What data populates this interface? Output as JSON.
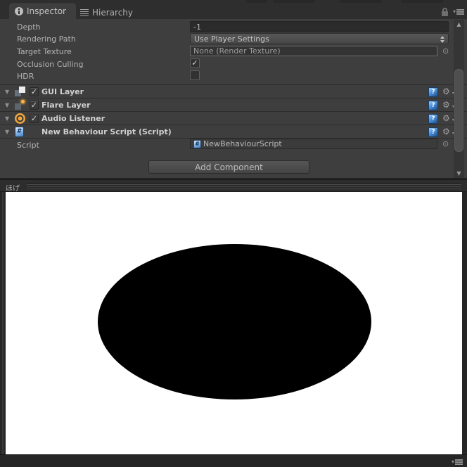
{
  "tabs": {
    "inspector": {
      "label": "Inspector"
    },
    "hierarchy": {
      "label": "Hierarchy"
    }
  },
  "camera": {
    "depth": {
      "label": "Depth",
      "value": "-1"
    },
    "rendering_path": {
      "label": "Rendering Path",
      "value": "Use Player Settings"
    },
    "target_texture": {
      "label": "Target Texture",
      "value": "None (Render Texture)"
    },
    "occlusion_culling": {
      "label": "Occlusion Culling",
      "checked": true
    },
    "hdr": {
      "label": "HDR",
      "checked": false
    }
  },
  "components": {
    "gui_layer": {
      "label": "GUI Layer",
      "enabled": true
    },
    "flare_layer": {
      "label": "Flare Layer",
      "enabled": true
    },
    "audio_listener": {
      "label": "Audio Listener",
      "enabled": true
    },
    "new_behaviour_script": {
      "label": "New Behaviour Script (Script)"
    }
  },
  "script_field": {
    "label": "Script",
    "value": "NewBehaviourScript"
  },
  "buttons": {
    "add_component": "Add Component"
  },
  "game_window": {
    "title": "ほげ"
  },
  "icons": {
    "checkmark": "✓",
    "foldout": "▼",
    "object_picker": "⊙",
    "scroll_up": "▲",
    "scroll_down": "▼",
    "gear": "⚙",
    "gear_caret": "▾",
    "menu_caret": "▾",
    "help": "?",
    "script_hash": "#"
  },
  "colors": {
    "panel_bg": "#3e3e3e",
    "tab_bar_bg": "#2e2e2e",
    "field_bg": "#2b2b2b",
    "accent_orange": "#f0a63c",
    "canvas_white": "#ffffff",
    "ellipse_black": "#000000"
  }
}
